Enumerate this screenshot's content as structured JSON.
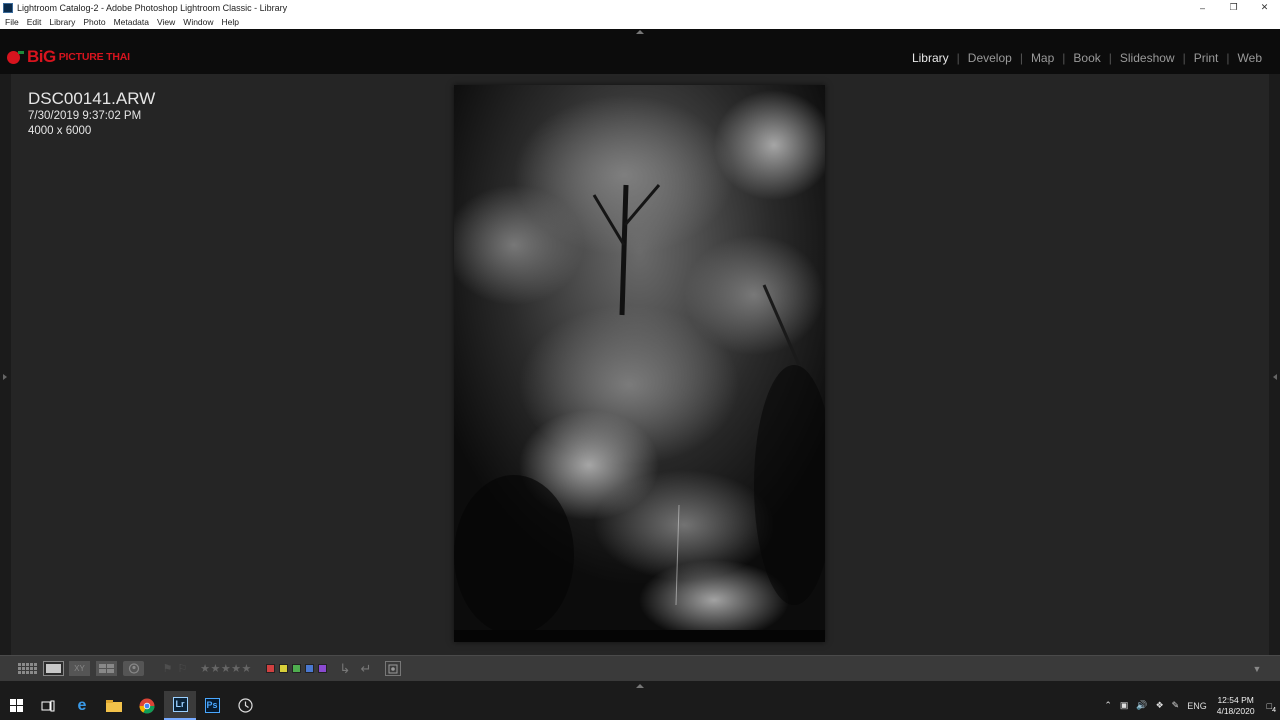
{
  "window": {
    "title": "Lightroom Catalog-2 - Adobe Photoshop Lightroom Classic - Library",
    "controls": [
      "minimize",
      "restore",
      "close"
    ]
  },
  "menu": [
    "File",
    "Edit",
    "Library",
    "Photo",
    "Metadata",
    "View",
    "Window",
    "Help"
  ],
  "identity_plate": {
    "big": "BiG",
    "sub": "PICTURE THAI",
    "colors": {
      "red": "#d7141e",
      "green": "#1e8a3a"
    }
  },
  "modules": {
    "items": [
      "Library",
      "Develop",
      "Map",
      "Book",
      "Slideshow",
      "Print",
      "Web"
    ],
    "active": "Library"
  },
  "photo_info": {
    "filename": "DSC00141.ARW",
    "datetime": "7/30/2019 9:37:02 PM",
    "dimensions": "4000 x 6000"
  },
  "toolbar": {
    "stars": "★★★★★",
    "color_labels": [
      "#d04040",
      "#d8cf3a",
      "#4fae4f",
      "#4a78d0",
      "#8a4ad0"
    ]
  },
  "taskbar": {
    "icons": [
      "windows-start-icon",
      "task-view-icon",
      "edge-icon",
      "file-explorer-icon",
      "chrome-icon",
      "lightroom-icon",
      "photoshop-icon",
      "clock-app-icon"
    ],
    "language": "ENG",
    "time": "12:54 PM",
    "date": "4/18/2020",
    "notification_count": "4"
  },
  "labels": {
    "lr": "Lr",
    "ps": "Ps",
    "xy": "XY"
  }
}
